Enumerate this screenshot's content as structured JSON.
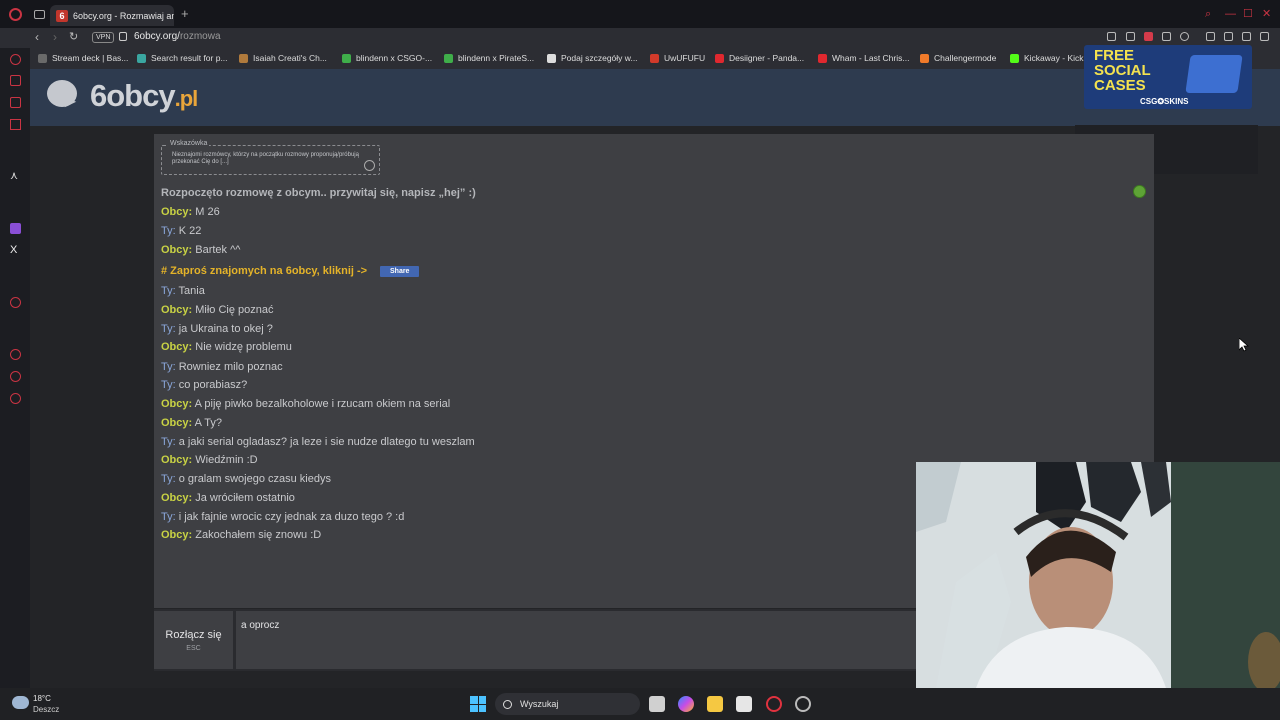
{
  "browser": {
    "tab_title": "6obcy.org - Rozmawiaj an",
    "tab_favicon": "6",
    "url_host": "6obcy.org/",
    "url_path": "rozmowa",
    "vpn_label": "VPN"
  },
  "bookmarks": [
    {
      "label": "Stream deck | Bas...",
      "color": "#6a6a6a"
    },
    {
      "label": "Search result for p...",
      "color": "#3aa6a0"
    },
    {
      "label": "Isaiah Creati's Ch...",
      "color": "#b07a3c"
    },
    {
      "label": "blindenn x CSGO-...",
      "color": "#3fae4a"
    },
    {
      "label": "blindenn x PirateS...",
      "color": "#3fae4a"
    },
    {
      "label": "Podaj szczegóły w...",
      "color": "#dddddd"
    },
    {
      "label": "UwUFUFU",
      "color": "#d23a2a"
    },
    {
      "label": "Desiigner - Panda...",
      "color": "#e0282f"
    },
    {
      "label": "Wham - Last Chris...",
      "color": "#e0282f"
    },
    {
      "label": "Challengermode",
      "color": "#f07a2a"
    },
    {
      "label": "Kickaway - Kick",
      "color": "#53fc18"
    }
  ],
  "site": {
    "logo_main": "6obcy",
    "logo_tld": ".pl"
  },
  "ad": {
    "line1": "FREE",
    "line2": "SOCIAL",
    "line3": "CASES",
    "brand": "CSG✪SKINS"
  },
  "hint": {
    "legend": "Wskazówka",
    "text": "Nieznajomi rozmówcy, którzy na początku rozmowy proponują/próbują przekonać Cię do [...]"
  },
  "chat": {
    "system_message": "Rozpoczęto rozmowę z obcym.. przywitaj się, napisz „hej” :)",
    "invite_message": "# Zaproś znajomych na 6obcy, kliknij ->",
    "share_label": "Share",
    "messages": [
      {
        "who": "Obcy:",
        "text": "M 26"
      },
      {
        "who": "Ty:",
        "text": "K 22"
      },
      {
        "who": "Obcy:",
        "text": "Bartek ^^"
      },
      {
        "who": "Ty:",
        "text": "Tania"
      },
      {
        "who": "Obcy:",
        "text": "Miło Cię poznać"
      },
      {
        "who": "Ty:",
        "text": "ja Ukraina to okej ?"
      },
      {
        "who": "Obcy:",
        "text": "Nie widzę problemu"
      },
      {
        "who": "Ty:",
        "text": "Rowniez milo poznac"
      },
      {
        "who": "Ty:",
        "text": "co porabiasz?"
      },
      {
        "who": "Obcy:",
        "text": "A piję piwko bezalkoholowe i rzucam okiem na serial"
      },
      {
        "who": "Obcy:",
        "text": "A Ty?"
      },
      {
        "who": "Ty:",
        "text": "a jaki serial ogladasz? ja leze i sie nudze dlatego tu weszlam"
      },
      {
        "who": "Obcy:",
        "text": "Wiedźmin :D"
      },
      {
        "who": "Ty:",
        "text": "o gralam swojego czasu kiedys"
      },
      {
        "who": "Obcy:",
        "text": "Ja wróciłem ostatnio"
      },
      {
        "who": "Ty:",
        "text": "i jak fajnie wrocic czy jednak za duzo tego ? :d"
      },
      {
        "who": "Obcy:",
        "text": "Zakochałem się znowu :D"
      }
    ],
    "disconnect_label": "Rozłącz się",
    "disconnect_key": "ESC",
    "input_value": "a oprocz "
  },
  "taskbar": {
    "temperature": "18°C",
    "weather": "Deszcz",
    "search_placeholder": "Wyszukaj"
  }
}
